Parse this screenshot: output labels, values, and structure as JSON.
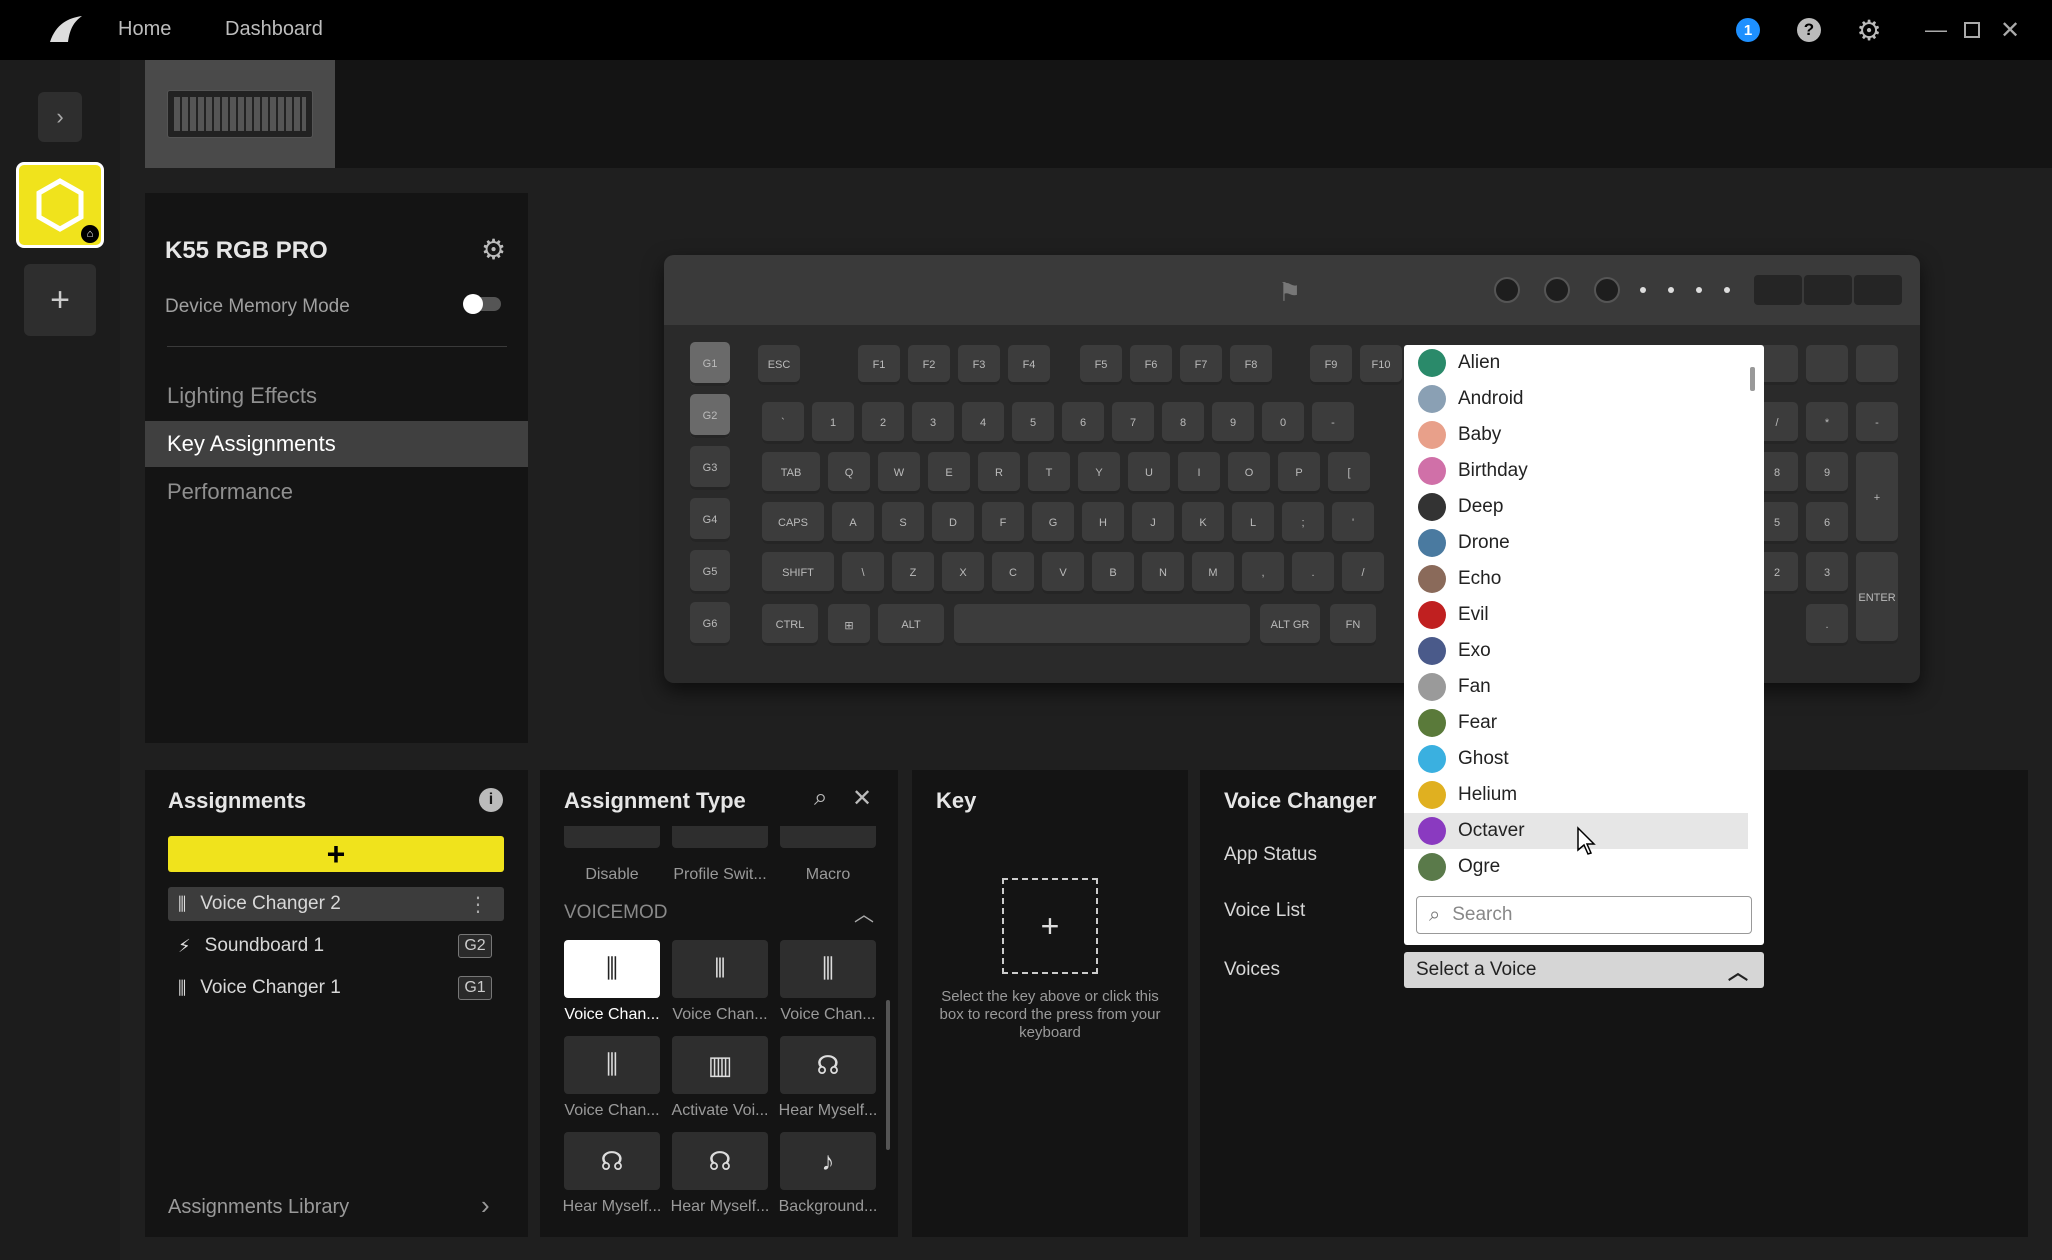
{
  "titlebar": {
    "nav_home": "Home",
    "nav_dashboard": "Dashboard",
    "notification_count": "1"
  },
  "colors": {
    "accent_yellow": "#f0e31c",
    "notification_blue": "#1e90ff",
    "background": "#1f1f1f"
  },
  "device": {
    "name": "K55 RGB PRO",
    "memory_mode_label": "Device Memory Mode"
  },
  "sidebar_menu": [
    {
      "label": "Lighting Effects"
    },
    {
      "label": "Key Assignments"
    },
    {
      "label": "Performance"
    }
  ],
  "assignments": {
    "title": "Assignments",
    "library_label": "Assignments Library",
    "items": [
      {
        "label": "Voice Changer 2",
        "badge": ""
      },
      {
        "label": "Soundboard 1",
        "badge": "G2"
      },
      {
        "label": "Voice Changer 1",
        "badge": "G1"
      }
    ]
  },
  "assignment_type": {
    "title": "Assignment Type",
    "top_labels": [
      "Disable",
      "Profile Swit...",
      "Macro"
    ],
    "section": "VOICEMOD",
    "tiles": [
      {
        "label": "Voice Chan...",
        "icon": "sliders-icon"
      },
      {
        "label": "Voice Chan...",
        "icon": "bars-icon"
      },
      {
        "label": "Voice Chan...",
        "icon": "sliders-down-icon"
      },
      {
        "label": "Voice Chan...",
        "icon": "sliders-x-icon"
      },
      {
        "label": "Activate Voi...",
        "icon": "voice-box-icon"
      },
      {
        "label": "Hear Myself...",
        "icon": "headphones-icon"
      },
      {
        "label": "Hear Myself...",
        "icon": "headphones-on-icon"
      },
      {
        "label": "Hear Myself...",
        "icon": "headphones-off-icon"
      },
      {
        "label": "Background...",
        "icon": "music-note-icon"
      }
    ]
  },
  "key_panel": {
    "title": "Key",
    "hint": "Select the key above or click this box to record the press from your keyboard"
  },
  "voice_changer": {
    "title": "Voice Changer",
    "app_status_label": "App Status",
    "voice_list_label": "Voice List",
    "voices_label": "Voices",
    "select_placeholder": "Select a Voice",
    "search_placeholder": "Search"
  },
  "voices": [
    {
      "name": "Alien",
      "color": "#2a8a6a"
    },
    {
      "name": "Android",
      "color": "#8aa0b4"
    },
    {
      "name": "Baby",
      "color": "#e8a08a"
    },
    {
      "name": "Birthday",
      "color": "#d070a8"
    },
    {
      "name": "Deep",
      "color": "#333333"
    },
    {
      "name": "Drone",
      "color": "#4a7aa0"
    },
    {
      "name": "Echo",
      "color": "#8a6a5a"
    },
    {
      "name": "Evil",
      "color": "#c02020"
    },
    {
      "name": "Exo",
      "color": "#4a5a8a"
    },
    {
      "name": "Fan",
      "color": "#9a9a9a"
    },
    {
      "name": "Fear",
      "color": "#5a7a3a"
    },
    {
      "name": "Ghost",
      "color": "#3ab0e0"
    },
    {
      "name": "Helium",
      "color": "#e0b020"
    },
    {
      "name": "Octaver",
      "color": "#8a3ac0"
    },
    {
      "name": "Ogre",
      "color": "#5a7a4a"
    }
  ],
  "keyboard": {
    "fn_row": [
      "ESC",
      "F1",
      "F2",
      "F3",
      "F4",
      "F5",
      "F6",
      "F7",
      "F8",
      "F9",
      "F10"
    ],
    "num_row": [
      "`",
      "1",
      "2",
      "3",
      "4",
      "5",
      "6",
      "7",
      "8",
      "9",
      "0",
      "-"
    ],
    "q_row": [
      "TAB",
      "Q",
      "W",
      "E",
      "R",
      "T",
      "Y",
      "U",
      "I",
      "O",
      "P",
      "["
    ],
    "a_row": [
      "CAPS",
      "A",
      "S",
      "D",
      "F",
      "G",
      "H",
      "J",
      "K",
      "L",
      ";",
      "'"
    ],
    "z_row": [
      "SHIFT",
      "\\",
      "Z",
      "X",
      "C",
      "V",
      "B",
      "N",
      "M",
      ",",
      ".",
      "/"
    ],
    "bottom_row": [
      "CTRL",
      "⊞",
      "ALT",
      "",
      "ALT GR",
      "FN"
    ],
    "g_keys": [
      "G1",
      "G2",
      "G3",
      "G4",
      "G5",
      "G6"
    ],
    "numpad": [
      "/",
      "*",
      "-",
      "8",
      "9",
      "+",
      "5",
      "6",
      "2",
      "3",
      ".",
      "ENTER"
    ]
  }
}
